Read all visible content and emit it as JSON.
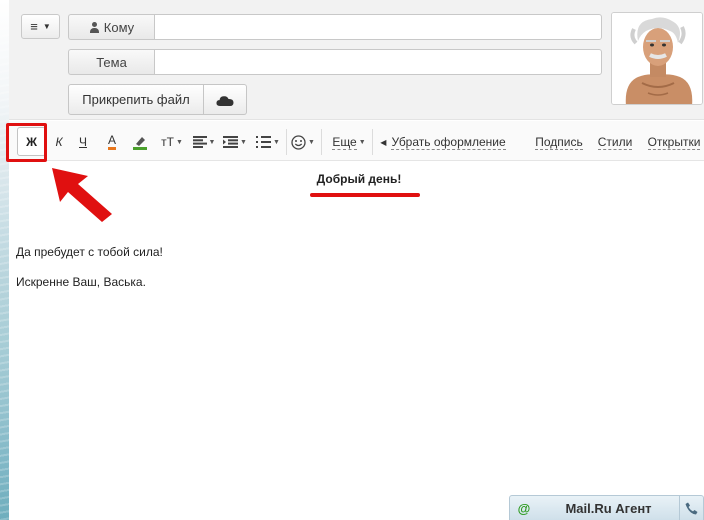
{
  "compose": {
    "to_label": "Кому",
    "to_value": "",
    "subject_label": "Тема",
    "subject_value": "",
    "attach_label": "Прикрепить файл"
  },
  "toolbar": {
    "bold": "Ж",
    "italic": "К",
    "underline": "Ч",
    "color": "А",
    "size": "тТ",
    "more": "Еще",
    "remove_format": "Убрать оформление",
    "signature": "Подпись",
    "styles": "Стили",
    "cards": "Открытки"
  },
  "message": {
    "greeting": "Добрый день!",
    "line1": "Да пребудет с тобой сила!",
    "line2": "Искренне Ваш, Васька."
  },
  "agent": {
    "title": "Mail.Ru Агент"
  },
  "colors": {
    "highlight": "#e01010",
    "text_color_bar": "#e8761c",
    "marker_green": "#4aa02c"
  }
}
